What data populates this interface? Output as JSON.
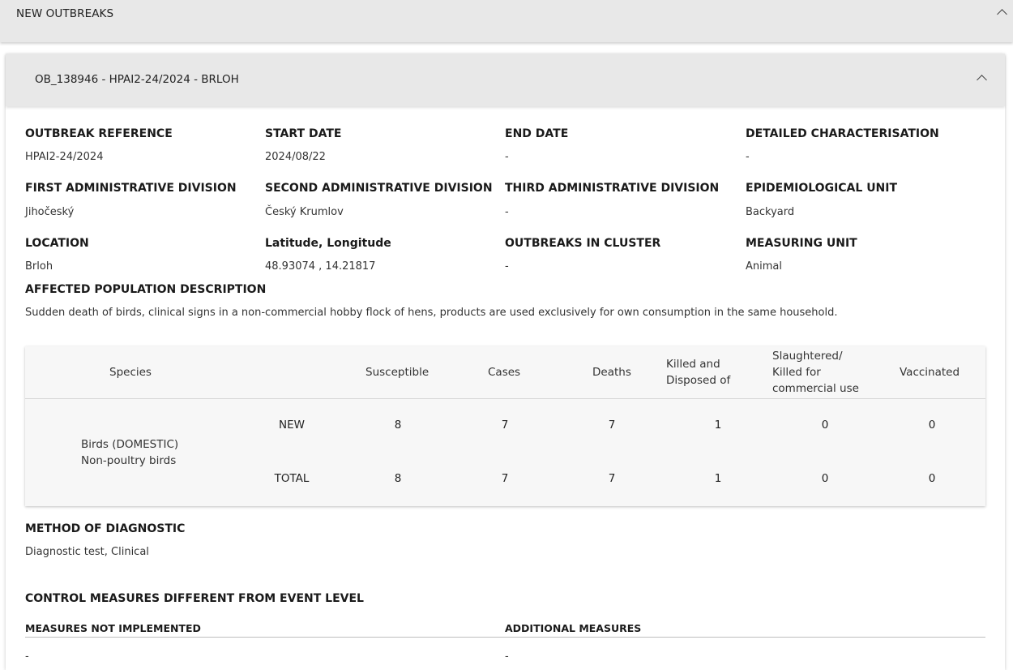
{
  "section": {
    "title": "NEW OUTBREAKS"
  },
  "outbreak": {
    "title": "OB_138946 - HPAI2-24/2024 - BRLOH",
    "fields": [
      {
        "label": "OUTBREAK REFERENCE",
        "value": "HPAI2-24/2024"
      },
      {
        "label": "START DATE",
        "value": "2024/08/22"
      },
      {
        "label": "END DATE",
        "value": "-"
      },
      {
        "label": "DETAILED CHARACTERISATION",
        "value": "-"
      },
      {
        "label": "FIRST ADMINISTRATIVE DIVISION",
        "value": "Jihočeský"
      },
      {
        "label": "SECOND ADMINISTRATIVE DIVISION",
        "value": "Český Krumlov"
      },
      {
        "label": "THIRD ADMINISTRATIVE DIVISION",
        "value": "-"
      },
      {
        "label": "EPIDEMIOLOGICAL UNIT",
        "value": "Backyard"
      },
      {
        "label": "LOCATION",
        "value": "Brloh"
      },
      {
        "label": "Latitude, Longitude",
        "value": "48.93074 , 14.21817"
      },
      {
        "label": "OUTBREAKS IN CLUSTER",
        "value": "-"
      },
      {
        "label": "MEASURING UNIT",
        "value": "Animal"
      }
    ],
    "population": {
      "label": "AFFECTED POPULATION DESCRIPTION",
      "value": "Sudden death of birds, clinical signs in a non-commercial hobby flock of hens, products are used exclusively for own consumption in the same household."
    },
    "table": {
      "headers": {
        "species": "Species",
        "susceptible": "Susceptible",
        "cases": "Cases",
        "deaths": "Deaths",
        "killed_line1": "Killed and",
        "killed_line2": "Disposed of",
        "slaughtered_line1": "Slaughtered/",
        "slaughtered_line2": "Killed for",
        "slaughtered_line3": "commercial use",
        "vaccinated": "Vaccinated"
      },
      "species_line1": "Birds (DOMESTIC)",
      "species_line2": "Non-poultry birds",
      "rows": [
        {
          "type": "NEW",
          "susceptible": "8",
          "cases": "7",
          "deaths": "7",
          "killed": "1",
          "slaughtered": "0",
          "vaccinated": "0"
        },
        {
          "type": "TOTAL",
          "susceptible": "8",
          "cases": "7",
          "deaths": "7",
          "killed": "1",
          "slaughtered": "0",
          "vaccinated": "0"
        }
      ]
    },
    "diagnostic": {
      "label": "METHOD OF DIAGNOSTIC",
      "value": "Diagnostic test, Clinical"
    },
    "control_measures": {
      "title": "CONTROL MEASURES DIFFERENT FROM EVENT LEVEL",
      "not_implemented_label": "MEASURES NOT IMPLEMENTED",
      "additional_label": "ADDITIONAL MEASURES",
      "not_implemented_value": "-",
      "additional_value": "-"
    }
  },
  "icons": {
    "section_collapse": "chevron-up-icon",
    "outbreak_collapse": "chevron-up-icon"
  }
}
